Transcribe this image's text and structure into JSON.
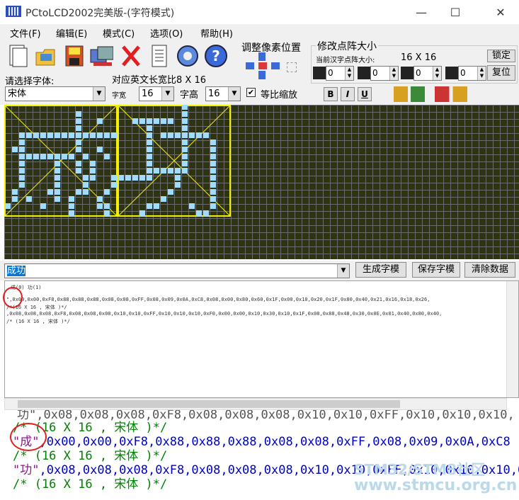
{
  "window": {
    "title": "PCtoLCD2002完美版-(字符模式)",
    "minimize": "—",
    "maximize": "☐",
    "close": "✕"
  },
  "menu": [
    "文件(F)",
    "编辑(E)",
    "模式(C)",
    "选项(O)",
    "帮助(H)"
  ],
  "toolbar": {
    "icons": [
      "new-icon",
      "open-icon",
      "save-icon",
      "export-icon",
      "delete-icon",
      "document-icon",
      "settings-icon",
      "help-icon"
    ],
    "font_label": "请选择字体:",
    "font_value": "宋体",
    "map_label": "对应英文长宽比8 X 16",
    "width_label": "字宽",
    "width_value": "16",
    "height_label": "字高",
    "height_value": "16",
    "scale_label": "等比缩放",
    "scale_checked": "✔",
    "bold": "B",
    "italic": "I",
    "underline": "U"
  },
  "pixel_group": {
    "title": "调整像素位置"
  },
  "matrix_group": {
    "title": "修改点阵大小",
    "current_label": "当前汉字点阵大小:",
    "current_value": "16  X  16",
    "lock_button": "锁定",
    "reset_button": "复位",
    "spins": [
      "0",
      "0",
      "0",
      "0"
    ]
  },
  "grid": {
    "char1": "成",
    "char2": "功"
  },
  "input": {
    "text": "成功",
    "generate_button": "生成字模",
    "save_button": "保存字模",
    "clear_button": "清除数据"
  },
  "output": {
    "lines": [
      "成(0) 功(1)",
      "\",0x00,0x00,0xF8,0x88,0x88,0x88,0x08,0x08,0xFF,0x08,0x09,0x0A,0xC8,0x08,0x00,0x80,0x60,0x1F,0x00,0x10,0x20,0x1F,0x80,0x40,0x21,0x16,0x18,0x26,",
      "/*(16 X 16 , 宋体 )*/",
      ",0x08,0x08,0x08,0xF8,0x08,0x08,0x08,0x10,0x10,0xFF,0x10,0x10,0x10,0xF0,0x00,0x00,0x10,0x30,0x10,0x1F,0x08,0x88,0x48,0x30,0x0E,0x01,0x40,0x80,0x40,",
      "/* (16 X 16 , 宋体 )*/"
    ]
  },
  "zoom": {
    "line0": "功\",0x08,0x08,0x08,0xF8,0x08,0x08,0x08,0x10,0x10,0xFF,0x10,0x10,0x10,",
    "line1": "/* (16 X 16 , 宋体 )*/",
    "line2_str": "\"成\"",
    "line2_hex": ",0x00,0x00,0xF8,0x88,0x88,0x88,0x08,0x08,0xFF,0x08,0x09,0x0A,0xC8",
    "line3": "/* (16 X 16 , 宋体 )*/",
    "line4_str": "\"功\"",
    "line4_hex": ",0x08,0x08,0x08,0xF8,0x08,0x08,0x08,0x10,0x10,0xFF,0x10,0x10,0x10,0",
    "line5": "/* (16 X 16 , 宋体 )*/"
  },
  "watermark": {
    "line1": "STM32/STM8社区",
    "line2": "www.stmcu.org.cn"
  }
}
